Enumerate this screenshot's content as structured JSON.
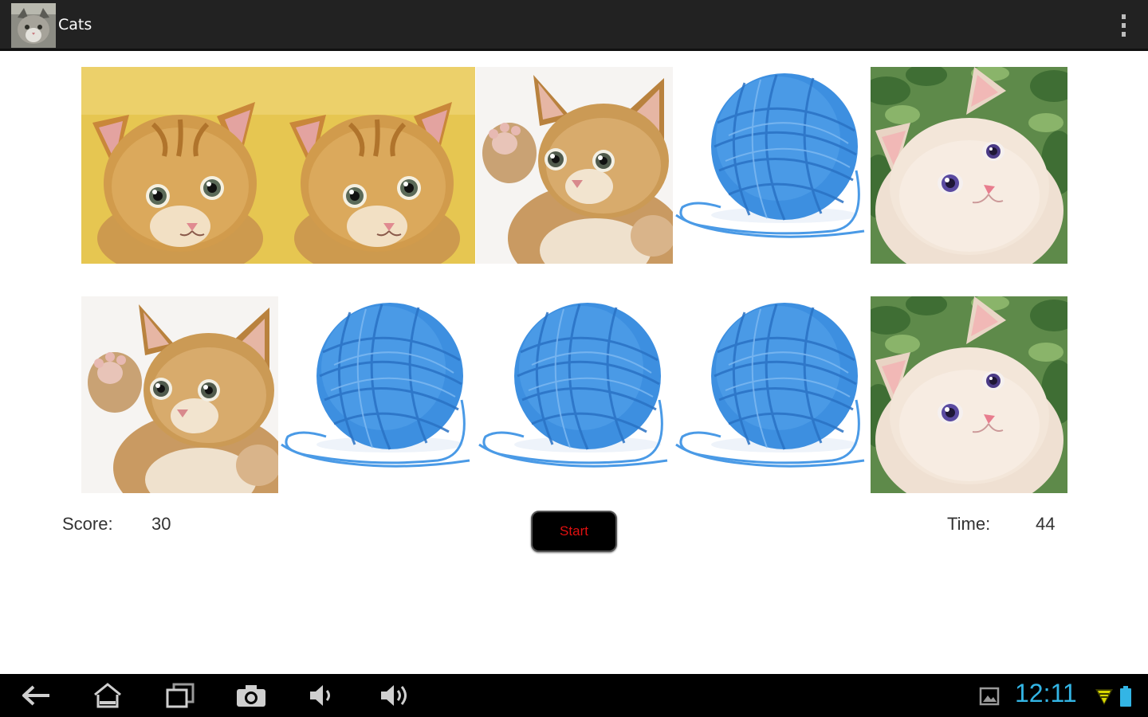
{
  "app": {
    "title": "Cats",
    "icon": "cat-app-icon",
    "overflow_icon": "overflow-menu-icon"
  },
  "board": {
    "tiles": [
      {
        "row": 1,
        "col": 1,
        "image": "ginger-kitten-yellow"
      },
      {
        "row": 1,
        "col": 2,
        "image": "ginger-kitten-yellow"
      },
      {
        "row": 1,
        "col": 3,
        "image": "waving-kitten"
      },
      {
        "row": 1,
        "col": 4,
        "image": "blue-yarn-ball"
      },
      {
        "row": 1,
        "col": 5,
        "image": "cream-kitten-leaves"
      },
      {
        "row": 2,
        "col": 1,
        "image": "waving-kitten"
      },
      {
        "row": 2,
        "col": 2,
        "image": "blue-yarn-ball"
      },
      {
        "row": 2,
        "col": 3,
        "image": "blue-yarn-ball"
      },
      {
        "row": 2,
        "col": 4,
        "image": "blue-yarn-ball"
      },
      {
        "row": 2,
        "col": 5,
        "image": "cream-kitten-leaves"
      }
    ]
  },
  "score": {
    "label": "Score:",
    "value": "30"
  },
  "time": {
    "label": "Time:",
    "value": "44"
  },
  "start_button": {
    "label": "Start"
  },
  "system_bar": {
    "clock": "12:11",
    "buttons": [
      "back-icon",
      "home-icon",
      "recent-apps-icon",
      "screenshot-icon",
      "volume-down-icon",
      "volume-up-icon"
    ],
    "status_icons": [
      "gallery-notification-icon",
      "wifi-icon",
      "battery-icon"
    ]
  },
  "colors": {
    "action_bar": "#222222",
    "start_text": "#e01010",
    "clock": "#33b5e5",
    "yarn": "#3d8fe0",
    "kitten_bg": "#e8c84a"
  }
}
